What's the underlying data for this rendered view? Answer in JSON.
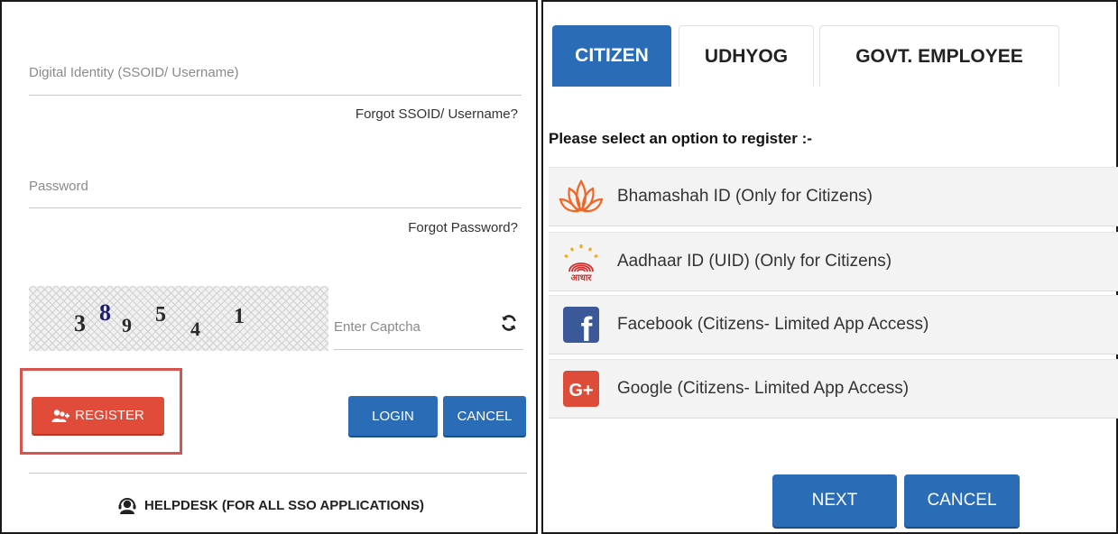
{
  "login": {
    "ssoid_placeholder": "Digital Identity (SSOID/ Username)",
    "forgot_ssoid": "Forgot SSOID/ Username?",
    "password_placeholder": "Password",
    "forgot_password": "Forgot Password?",
    "captcha_digits": [
      "3",
      "8",
      "9",
      "5",
      "4",
      "1"
    ],
    "captcha_placeholder": "Enter Captcha",
    "register_label": "REGISTER",
    "login_label": "LOGIN",
    "cancel_label": "CANCEL",
    "helpdesk_label": "HELPDESK (FOR ALL SSO APPLICATIONS)"
  },
  "register": {
    "tabs": [
      {
        "label": "CITIZEN",
        "active": true
      },
      {
        "label": "UDHYOG",
        "active": false
      },
      {
        "label": "GOVT. EMPLOYEE",
        "active": false
      }
    ],
    "prompt": "Please select an option to register :-",
    "options": [
      {
        "label": "Bhamashah ID (Only for Citizens)",
        "icon": "bhamashah-lotus-icon"
      },
      {
        "label": "Aadhaar ID (UID) (Only for Citizens)",
        "icon": "aadhaar-logo-icon",
        "icon_text": "आधार"
      },
      {
        "label": "Facebook (Citizens- Limited App Access)",
        "icon": "facebook-icon",
        "icon_text": "f"
      },
      {
        "label": "Google (Citizens- Limited App Access)",
        "icon": "google-plus-icon",
        "icon_text": "G+"
      }
    ],
    "next_label": "NEXT",
    "cancel_label": "CANCEL"
  },
  "colors": {
    "primary_blue": "#2a6cb5",
    "register_red": "#e04b3a",
    "highlight_border": "#d9534f",
    "facebook_blue": "#3b5998",
    "google_red": "#dd4b39"
  }
}
